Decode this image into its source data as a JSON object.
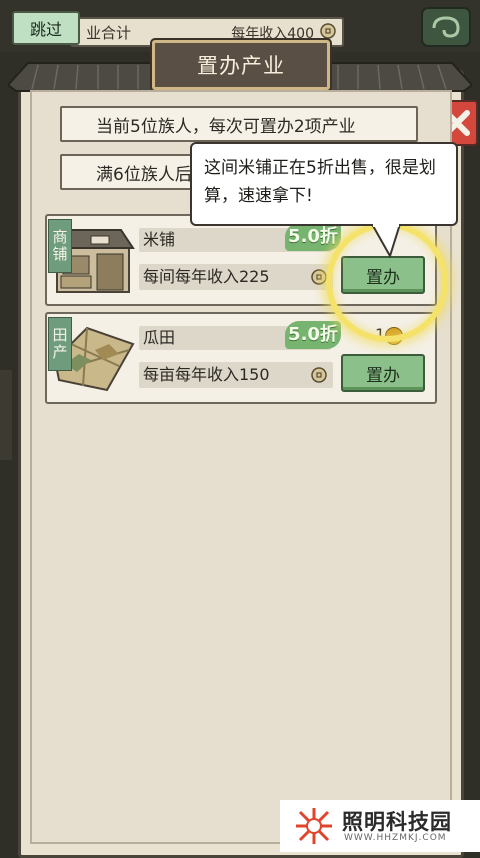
{
  "top_bar": {
    "skip_label": "跳过",
    "left_text": "业合计",
    "income_text": "每年收入400"
  },
  "dialog": {
    "title": "置办产业",
    "info_line_1": "当前5位族人，每次可置办2项产业",
    "info_line_2": "满6位族人后"
  },
  "tooltip": {
    "text": "这间米铺正在5折出售，很是划算，速速拿下!"
  },
  "properties": [
    {
      "category": "商铺",
      "name": "米铺",
      "discount": "5.0折",
      "income": "每间每年收入225",
      "button_label": "置办"
    },
    {
      "category": "田产",
      "name": "瓜田",
      "discount": "5.0折",
      "count": "1",
      "income": "每亩每年收入150",
      "button_label": "置办"
    }
  ],
  "footer": {
    "site_name": "照明科技园",
    "url": "WWW.HHZMKJ.COM"
  },
  "colors": {
    "accent_green": "#8cc08a",
    "discount_green": "#76b46f",
    "close_red": "#d4473d",
    "highlight_yellow": "#f4e26a"
  }
}
